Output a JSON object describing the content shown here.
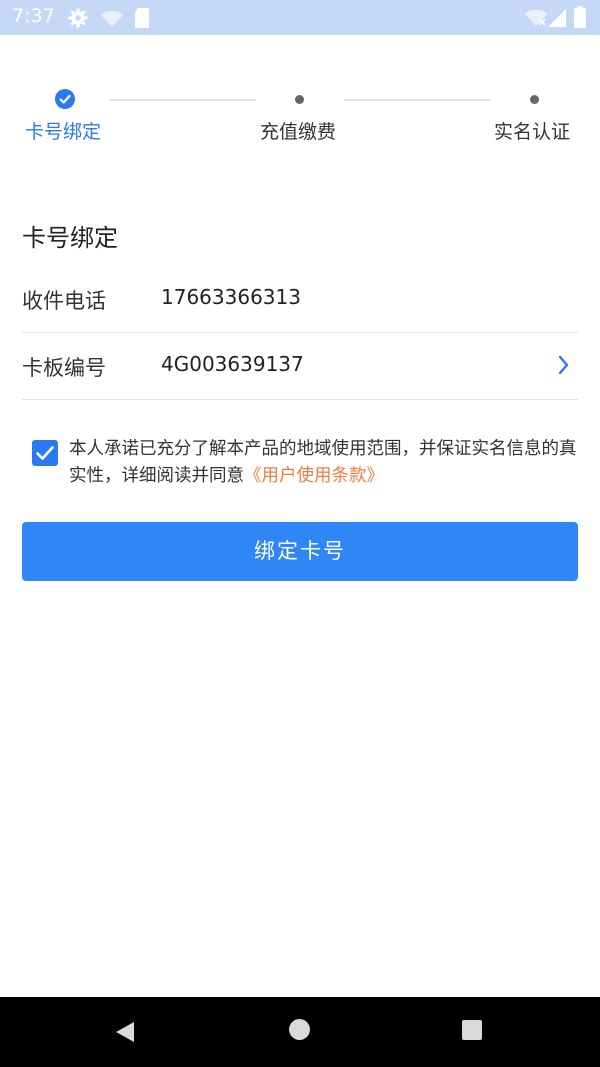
{
  "status_bar": {
    "time": "7:37",
    "icons": [
      "gear-icon",
      "wifi-question-icon",
      "sd-card-icon",
      "wifi-off-icon",
      "signal-icon",
      "battery-icon"
    ]
  },
  "stepper": {
    "steps": [
      {
        "label": "卡号绑定",
        "state": "done"
      },
      {
        "label": "充值缴费",
        "state": "pending"
      },
      {
        "label": "实名认证",
        "state": "pending"
      }
    ]
  },
  "section": {
    "title": "卡号绑定"
  },
  "form": {
    "phone": {
      "label": "收件电话",
      "value": "17663366313"
    },
    "card": {
      "label": "卡板编号",
      "value": "4G003639137"
    }
  },
  "agreement": {
    "checked": true,
    "text": "本人承诺已充分了解本产品的地域使用范围，并保证实名信息的真实性，详细阅读并同意",
    "link": "《用户使用条款》"
  },
  "bind_button": {
    "label": "绑定卡号"
  },
  "colors": {
    "accent": "#2a7af1",
    "button": "#2f86f6",
    "link": "#f37c3c",
    "status_bar": "#c5d9f7"
  }
}
